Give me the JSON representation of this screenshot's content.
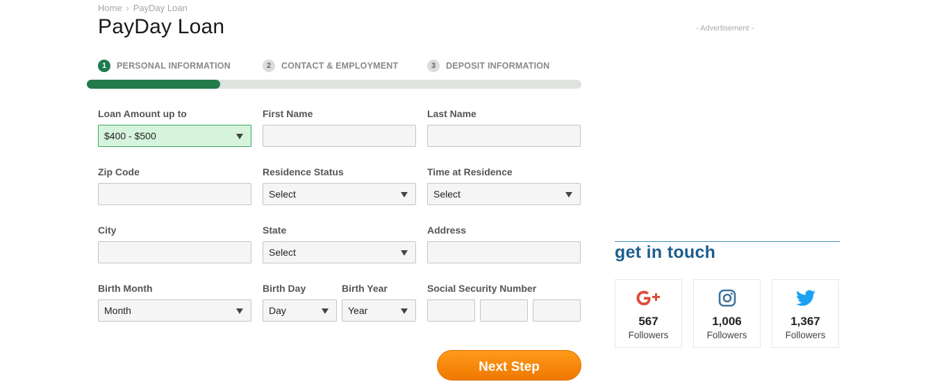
{
  "breadcrumb": {
    "home": "Home",
    "separator": "›",
    "current": "PayDay Loan"
  },
  "page": {
    "title": "PayDay Loan"
  },
  "ad": {
    "label": "- Advertisement -"
  },
  "steps": [
    {
      "num": "1",
      "label": "PERSONAL INFORMATION",
      "active": true
    },
    {
      "num": "2",
      "label": "CONTACT & EMPLOYMENT",
      "active": false
    },
    {
      "num": "3",
      "label": "DEPOSIT INFORMATION",
      "active": false
    }
  ],
  "progress": {
    "fraction": 0.27
  },
  "form": {
    "loan_amount": {
      "label": "Loan Amount up to",
      "value": "$400 - $500"
    },
    "first_name": {
      "label": "First Name",
      "value": ""
    },
    "last_name": {
      "label": "Last Name",
      "value": ""
    },
    "zip": {
      "label": "Zip Code",
      "value": ""
    },
    "residence_status": {
      "label": "Residence Status",
      "value": "Select"
    },
    "time_at_residence": {
      "label": "Time at Residence",
      "value": "Select"
    },
    "city": {
      "label": "City",
      "value": ""
    },
    "state": {
      "label": "State",
      "value": "Select"
    },
    "address": {
      "label": "Address",
      "value": ""
    },
    "birth_month": {
      "label": "Birth Month",
      "value": "Month"
    },
    "birth_day": {
      "label": "Birth Day",
      "value": "Day"
    },
    "birth_year": {
      "label": "Birth Year",
      "value": "Year"
    },
    "ssn": {
      "label": "Social Security Number"
    }
  },
  "next_button": {
    "label": "Next Step"
  },
  "get_in_touch": {
    "title": "get in touch",
    "items": [
      {
        "icon": "google-plus-icon",
        "count": "567",
        "label": "Followers",
        "color": "#dd4b39"
      },
      {
        "icon": "instagram-icon",
        "count": "1,006",
        "label": "Followers",
        "color": "#3f729b"
      },
      {
        "icon": "twitter-icon",
        "count": "1,367",
        "label": "Followers",
        "color": "#1da1f2"
      }
    ]
  },
  "colors": {
    "accent_green": "#237a4a",
    "button_orange": "#f7890c",
    "heading_blue": "#1c5e8e"
  }
}
